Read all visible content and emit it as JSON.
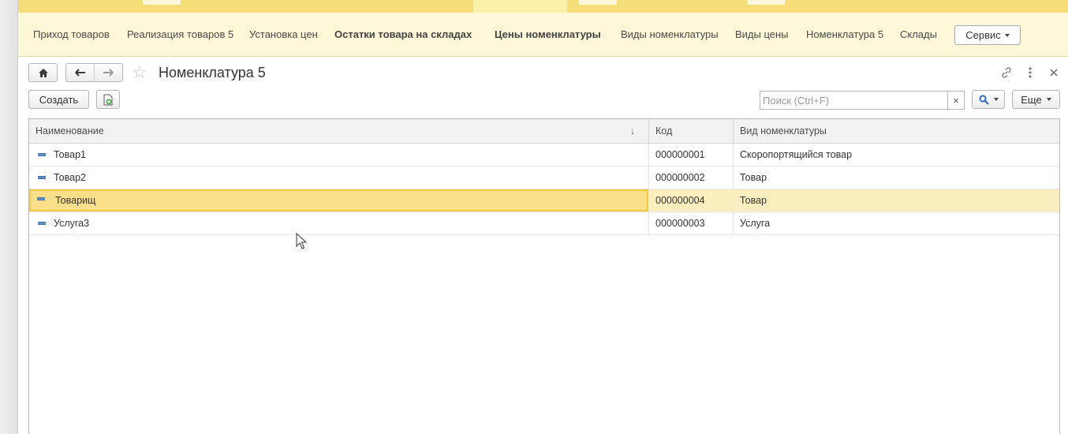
{
  "app": {
    "colors": {
      "accent": "#f5dd78",
      "navbar_bg": "#fcf7d7",
      "selection_bg": "#fcefbf",
      "selection_border": "#f2ca3c",
      "item_icon": "#5c8fc4"
    }
  },
  "navbar": {
    "links": [
      {
        "label": "Приход товаров",
        "bold": false
      },
      {
        "label": "Реализация товаров 5",
        "bold": false
      },
      {
        "label": "Установка цен",
        "bold": false
      },
      {
        "label": "Остатки товара на складах",
        "bold": true
      },
      {
        "label": "Цены номенклатуры",
        "bold": true
      },
      {
        "label": "Виды номенклатуры",
        "bold": false
      },
      {
        "label": "Виды цены",
        "bold": false
      },
      {
        "label": "Номенклатура 5",
        "bold": false
      },
      {
        "label": "Склады",
        "bold": false
      }
    ],
    "service_label": "Сервис"
  },
  "header": {
    "title": "Номенклатура 5",
    "icons": [
      "home-icon",
      "back-arrow-icon",
      "forward-arrow-icon",
      "star-icon",
      "link-icon",
      "more-vertical-icon",
      "close-icon"
    ]
  },
  "toolbar": {
    "create_label": "Создать",
    "copy_icon": "copy-document-icon",
    "search_placeholder": "Поиск (Ctrl+F)",
    "search_clear": "×",
    "search_icon": "magnifier-icon",
    "more_label": "Еще"
  },
  "table": {
    "columns": [
      "Наименование",
      "Код",
      "Вид номенклатуры"
    ],
    "sort_indicator": "↓",
    "rows": [
      {
        "name": "Товар1",
        "code": "000000001",
        "kind": "Скоропортящийся товар",
        "selected": false
      },
      {
        "name": "Товар2",
        "code": "000000002",
        "kind": "Товар",
        "selected": false
      },
      {
        "name": "Товарищ",
        "code": "000000004",
        "kind": "Товар",
        "selected": true
      },
      {
        "name": "Услуга3",
        "code": "000000003",
        "kind": "Услуга",
        "selected": false
      }
    ]
  }
}
